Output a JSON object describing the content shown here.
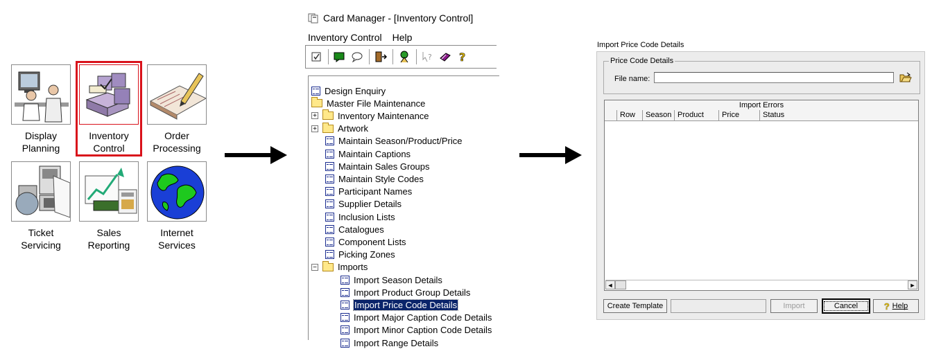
{
  "launcher": {
    "tiles": [
      {
        "line1": "Display",
        "line2": "Planning",
        "icon": "display-planning-icon"
      },
      {
        "line1": "Inventory",
        "line2": "Control",
        "icon": "inventory-control-icon"
      },
      {
        "line1": "Order",
        "line2": "Processing",
        "icon": "order-processing-icon"
      },
      {
        "line1": "Ticket",
        "line2": "Servicing",
        "icon": "ticket-servicing-icon"
      },
      {
        "line1": "Sales",
        "line2": "Reporting",
        "icon": "sales-reporting-icon"
      },
      {
        "line1": "Internet",
        "line2": "Services",
        "icon": "internet-services-icon"
      }
    ],
    "highlight_color": "#d9121b"
  },
  "card_manager": {
    "title": "Card Manager - [Inventory Control]",
    "menu": [
      "Inventory Control",
      "Help"
    ],
    "tree": [
      {
        "label": "Design Enquiry",
        "type": "doc"
      },
      {
        "label": "Master File Maintenance",
        "type": "folder"
      },
      {
        "label": "Inventory Maintenance",
        "type": "folder",
        "expander": "+"
      },
      {
        "label": "Artwork",
        "type": "folder",
        "expander": "+"
      },
      {
        "label": "Maintain Season/Product/Price",
        "type": "doc"
      },
      {
        "label": "Maintain Captions",
        "type": "doc"
      },
      {
        "label": "Maintain Sales Groups",
        "type": "doc"
      },
      {
        "label": "Maintain Style Codes",
        "type": "doc"
      },
      {
        "label": "Participant Names",
        "type": "doc"
      },
      {
        "label": "Supplier Details",
        "type": "doc"
      },
      {
        "label": "Inclusion Lists",
        "type": "doc"
      },
      {
        "label": "Catalogues",
        "type": "doc"
      },
      {
        "label": "Component Lists",
        "type": "doc"
      },
      {
        "label": "Picking Zones",
        "type": "doc"
      },
      {
        "label": "Imports",
        "type": "folder",
        "expander": "−"
      },
      {
        "label": "Import Season Details",
        "type": "doc"
      },
      {
        "label": "Import Product Group Details",
        "type": "doc"
      },
      {
        "label": "Import Price Code Details",
        "type": "doc",
        "selected": true
      },
      {
        "label": "Import Major Caption Code Details",
        "type": "doc"
      },
      {
        "label": "Import Minor Caption Code Details",
        "type": "doc"
      },
      {
        "label": "Import Range Details",
        "type": "doc"
      }
    ],
    "selection_color": "#0a246a"
  },
  "dialog": {
    "title": "Import Price Code Details",
    "group_label": "Price Code Details",
    "file_label": "File name:",
    "file_value": "",
    "grid_title": "Import Errors",
    "columns": [
      "Row",
      "Season",
      "Product",
      "Price",
      "Status"
    ],
    "buttons": {
      "create_template": "Create Template",
      "import": "Import",
      "cancel": "Cancel",
      "help": "Help"
    }
  }
}
